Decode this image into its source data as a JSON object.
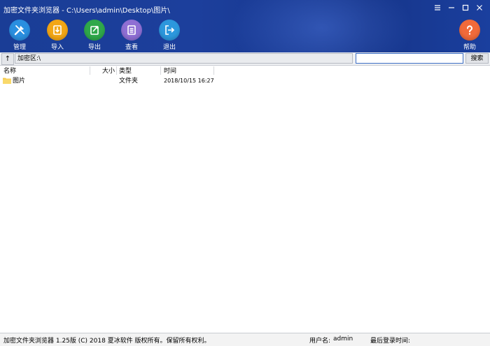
{
  "window": {
    "title": "加密文件夹浏览器 - C:\\Users\\admin\\Desktop\\图片\\",
    "controls": {
      "settings": "≡",
      "minimize": "—",
      "maximize": "☐",
      "close": "✕"
    }
  },
  "toolbar": {
    "items": [
      {
        "label": "管理",
        "icon": "tools-icon",
        "color": "#2a8fe0"
      },
      {
        "label": "导入",
        "icon": "import-icon",
        "color": "#f2a615"
      },
      {
        "label": "导出",
        "icon": "export-icon",
        "color": "#2fa84a"
      },
      {
        "label": "查看",
        "icon": "view-icon",
        "color": "#8f6fd4"
      },
      {
        "label": "退出",
        "icon": "exit-icon",
        "color": "#2c97dd"
      }
    ],
    "help": {
      "label": "帮助",
      "icon": "help-icon",
      "color": "#f06a3a"
    }
  },
  "pathbar": {
    "up_label": "↑",
    "path": "加密区:\\",
    "search_value": "",
    "search_button": "搜索"
  },
  "list": {
    "columns": [
      "名称",
      "大小",
      "类型",
      "时间"
    ],
    "rows": [
      {
        "name": "图片",
        "size": "",
        "type": "文件夹",
        "time": "2018/10/15 16:27"
      }
    ]
  },
  "status": {
    "copyright": "加密文件夹浏览器 1.25版 (C) 2018 夏冰软件 版权所有。保留所有权利。",
    "user_label": "用户名:",
    "user_value": "admin",
    "last_login_label": "最后登录时间:"
  }
}
